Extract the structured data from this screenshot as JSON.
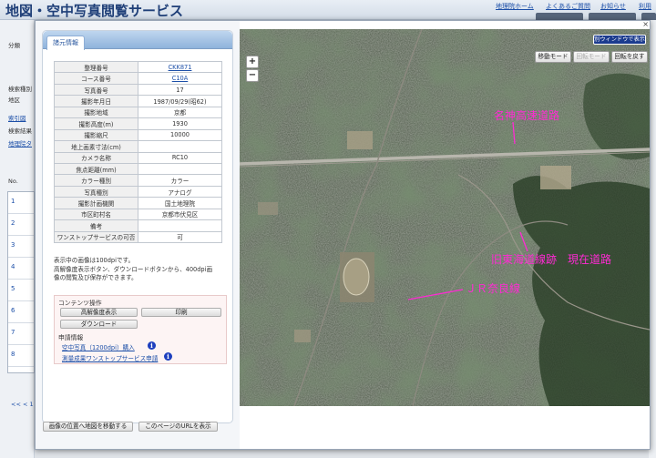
{
  "background": {
    "site_title": "地図・空中写真閲覧サービス",
    "nav": [
      "地理院ホーム",
      "よくあるご質問",
      "お知らせ",
      "利用"
    ],
    "left_labels": [
      "分類",
      "検索種別",
      "地区",
      "検索結果",
      "地理院"
    ],
    "left_links": [
      "索引図",
      "地理院タ"
    ],
    "list_header": "No.",
    "row_numbers": [
      "1",
      "2",
      "3",
      "4",
      "5",
      "6",
      "7",
      "8"
    ],
    "pager": "<< < 1"
  },
  "info_panel": {
    "tab_label": "諸元情報",
    "attributes": [
      {
        "key": "整理番号",
        "value": "CKK871",
        "link": true
      },
      {
        "key": "コース番号",
        "value": "C10A",
        "link": true
      },
      {
        "key": "写真番号",
        "value": "17",
        "link": false
      },
      {
        "key": "撮影年月日",
        "value": "1987/09/29(昭62)",
        "link": false
      },
      {
        "key": "撮影地域",
        "value": "京都",
        "link": false
      },
      {
        "key": "撮影高度(m)",
        "value": "1930",
        "link": false
      },
      {
        "key": "撮影縮尺",
        "value": "10000",
        "link": false
      },
      {
        "key": "地上画素寸法(cm)",
        "value": "",
        "link": false
      },
      {
        "key": "カメラ名称",
        "value": "RC10",
        "link": false
      },
      {
        "key": "焦点距離(mm)",
        "value": "",
        "link": false
      },
      {
        "key": "カラー種別",
        "value": "カラー",
        "link": false
      },
      {
        "key": "写真種別",
        "value": "アナログ",
        "link": false
      },
      {
        "key": "撮影計画機関",
        "value": "国土地理院",
        "link": false
      },
      {
        "key": "市区町村名",
        "value": "京都市伏見区",
        "link": false
      },
      {
        "key": "備考",
        "value": "",
        "link": false
      },
      {
        "key": "ワンストップサービスの可否",
        "value": "可",
        "link": false
      }
    ],
    "note_line1": "表示中の画像は100dpiです。",
    "note_line2": "高解像度表示ボタン、ダウンロードボタンから、400dpi画",
    "note_line3": "像の閲覧及び保存ができます。",
    "contents_title": "コンテンツ操作",
    "btn_highres": "高解像度表示",
    "btn_print": "印刷",
    "btn_download": "ダウンロード",
    "apply_title": "申請情報",
    "link_purchase": "空中写真（1200dpi）購入",
    "link_onestop": "測量成果ワンストップサービス申請"
  },
  "bottom_buttons": {
    "move_map": "画像の位置へ地図を移動する",
    "show_url": "このページのURLを表示"
  },
  "map": {
    "zoom_in": "+",
    "zoom_out": "−",
    "new_window": "別ウィンドウで表示",
    "move_mode": "移動モード",
    "rotate_mode": "回転モード",
    "reset_rotation": "回転を戻す",
    "annotations": {
      "meishin": "名神高速道路",
      "old_tokaido": "旧東海道線跡　現在道路",
      "jr_nara": "ＪＲ奈良線"
    },
    "annotation_color": "#ff2ad4"
  },
  "close_label": "×"
}
